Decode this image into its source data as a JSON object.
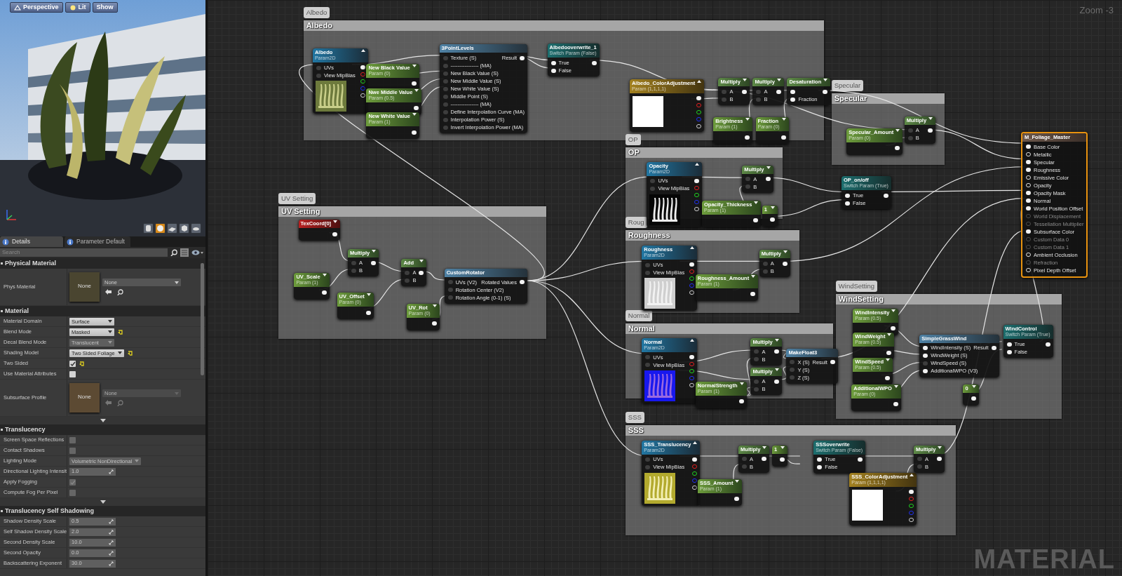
{
  "viewport": {
    "buttons": [
      {
        "label": "Perspective"
      },
      {
        "label": "Lit"
      },
      {
        "label": "Show"
      }
    ],
    "preview_shapes": [
      {
        "selected": false
      },
      {
        "selected": true
      },
      {
        "selected": false
      },
      {
        "selected": false
      },
      {
        "selected": false
      }
    ]
  },
  "details": {
    "tabs": [
      {
        "label": "Details",
        "selected": true
      },
      {
        "label": "Parameter Default",
        "selected": false
      }
    ],
    "search": {
      "placeholder": "Search"
    },
    "sections": [
      {
        "title": "Physical Material",
        "more": false,
        "rows": [
          {
            "kind": "asset",
            "label": "Phys Material",
            "thumbnail": "None",
            "value": "None",
            "color": "#4a4530",
            "disabled": false
          }
        ]
      },
      {
        "title": "Material",
        "more": true,
        "rows": [
          {
            "kind": "dropdown",
            "label": "Material Domain",
            "value": "Surface",
            "disabled": false,
            "reset": false
          },
          {
            "kind": "dropdown",
            "label": "Blend Mode",
            "value": "Masked",
            "disabled": false,
            "reset": true
          },
          {
            "kind": "dropdown",
            "label": "Decal Blend Mode",
            "value": "Translucent",
            "disabled": true,
            "reset": false
          },
          {
            "kind": "dropdown",
            "label": "Shading Model",
            "value": "Two Sided Foliage",
            "disabled": false,
            "reset": true
          },
          {
            "kind": "checkbox",
            "label": "Two Sided",
            "checked": true,
            "disabled": false,
            "reset": true
          },
          {
            "kind": "checkbox",
            "label": "Use Material Attributes",
            "checked": false,
            "disabled": false,
            "reset": false
          },
          {
            "kind": "asset",
            "label": "Subsurface Profile",
            "thumbnail": "None",
            "value": "None",
            "color": "#5c4a33",
            "disabled": true
          }
        ]
      },
      {
        "title": "Translucency",
        "more": true,
        "rows": [
          {
            "kind": "checkbox",
            "label": "Screen Space Reflections",
            "checked": false,
            "disabled": true,
            "reset": false
          },
          {
            "kind": "checkbox",
            "label": "Contact Shadows",
            "checked": false,
            "disabled": true,
            "reset": false
          },
          {
            "kind": "dropdown",
            "label": "Lighting Mode",
            "value": "Volumetric NonDirectional",
            "disabled": true,
            "reset": false
          },
          {
            "kind": "number",
            "label": "Directional Lighting Intensit",
            "value": "1.0",
            "disabled": true
          },
          {
            "kind": "checkbox",
            "label": "Apply Fogging",
            "checked": true,
            "disabled": true,
            "reset": false
          },
          {
            "kind": "checkbox",
            "label": "Compute Fog Per Pixel",
            "checked": false,
            "disabled": true,
            "reset": false
          }
        ]
      },
      {
        "title": "Translucency Self Shadowing",
        "more": false,
        "rows": [
          {
            "kind": "number",
            "label": "Shadow Density Scale",
            "value": "0.5",
            "disabled": true
          },
          {
            "kind": "number",
            "label": "Self Shadow Density Scale",
            "value": "2.0",
            "disabled": true
          },
          {
            "kind": "number",
            "label": "Second Density Scale",
            "value": "10.0",
            "disabled": true
          },
          {
            "kind": "number",
            "label": "Second Opacity",
            "value": "0.0",
            "disabled": true
          },
          {
            "kind": "number",
            "label": "Backscattering Exponent",
            "value": "30.0",
            "disabled": true
          }
        ]
      }
    ]
  },
  "graph": {
    "zoom": "Zoom -3",
    "type_label": "MATERIAL",
    "comments": [
      {
        "bubble": "Albedo",
        "title": "Albedo"
      },
      {
        "bubble": "Specular",
        "title": "Specular"
      },
      {
        "bubble": "OP",
        "title": "OP"
      },
      {
        "bubble": "UV Setting",
        "title": "UV Setting"
      },
      {
        "bubble": "Roug",
        "title": "Roughness"
      },
      {
        "bubble": "WindSetting",
        "title": "WindSetting"
      },
      {
        "bubble": "Normal",
        "title": "Normal"
      },
      {
        "bubble": "SSS",
        "title": "SSS"
      }
    ],
    "nodes": [
      {
        "kind": "texture",
        "title": "Albedo",
        "subtitle": "Param2D",
        "inputs": [
          {
            "label": "UVs",
            "linked": false
          },
          {
            "label": "View MipBias",
            "linked": false
          }
        ]
      },
      {
        "kind": "param",
        "title": "New Black Value",
        "subtitle": "Param (0)"
      },
      {
        "kind": "param",
        "title": "Nwe Middle Value",
        "subtitle": "Param (0.5)"
      },
      {
        "kind": "param",
        "title": "New White Value",
        "subtitle": "Param (1)"
      },
      {
        "kind": "function",
        "title": "3PointLevels",
        "output": "Result",
        "inputs": [
          {
            "label": "Texture (S)",
            "linked": false
          },
          {
            "label": "---------------- (MA)",
            "linked": false
          },
          {
            "label": "New Black Value (S)",
            "linked": false
          },
          {
            "label": "New Middle Value (S)",
            "linked": false
          },
          {
            "label": "New White Value (S)",
            "linked": false
          },
          {
            "label": "Middle Point (S)",
            "linked": false
          },
          {
            "label": "---------------- (MA)",
            "linked": false
          },
          {
            "label": "Define Interpolation Curve (MA)",
            "linked": false
          },
          {
            "label": "Interpolation Power (S)",
            "linked": false
          },
          {
            "label": "Invert Interpolation Power (MA)",
            "linked": false
          }
        ]
      },
      {
        "kind": "switch",
        "title": "Albedooverwrite_1",
        "subtitle": "Switch Param (False)",
        "inputs": [
          {
            "label": "True",
            "linked": true
          },
          {
            "label": "False",
            "linked": true
          }
        ]
      },
      {
        "kind": "vector",
        "title": "Albedo_ColorAdjustment",
        "subtitle": "Param (1,1,1,1)"
      },
      {
        "kind": "math",
        "title": "Multiply",
        "inputs": [
          {
            "label": "A",
            "linked": false
          },
          {
            "label": "B",
            "linked": false
          }
        ]
      },
      {
        "kind": "math",
        "title": "Multiply",
        "inputs": [
          {
            "label": "A",
            "linked": false
          },
          {
            "label": "B",
            "linked": false
          }
        ]
      },
      {
        "kind": "math",
        "title": "Desaturation",
        "inputs": [
          {
            "linked": true
          },
          {
            "label": "Fraction",
            "linked": true
          }
        ]
      },
      {
        "kind": "param",
        "title": "Brightness",
        "subtitle": "Param (1)"
      },
      {
        "kind": "param",
        "title": "Fraction",
        "subtitle": "Param (0)"
      },
      {
        "kind": "param",
        "title": "Specular_Amount",
        "subtitle": "Param (0)"
      },
      {
        "kind": "math",
        "title": "Multiply",
        "inputs": [
          {
            "label": "A",
            "linked": false
          },
          {
            "label": "B",
            "linked": false
          }
        ]
      },
      {
        "kind": "master",
        "title": "M_Foliage_Master",
        "inputs": [
          {
            "label": "Base Color",
            "linked": true,
            "disabled": false
          },
          {
            "label": "Metallic",
            "linked": false,
            "disabled": false
          },
          {
            "label": "Specular",
            "linked": true,
            "disabled": false
          },
          {
            "label": "Roughness",
            "linked": true,
            "disabled": false
          },
          {
            "label": "Emissive Color",
            "linked": false,
            "disabled": false
          },
          {
            "label": "Opacity",
            "linked": false,
            "disabled": false
          },
          {
            "label": "Opacity Mask",
            "linked": true,
            "disabled": false
          },
          {
            "label": "Normal",
            "linked": true,
            "disabled": false
          },
          {
            "label": "World Position Offset",
            "linked": true,
            "disabled": false
          },
          {
            "label": "World Displacement",
            "linked": false,
            "disabled": true
          },
          {
            "label": "Tessellation Multiplier",
            "linked": false,
            "disabled": true
          },
          {
            "label": "Subsurface Color",
            "linked": true,
            "disabled": false
          },
          {
            "label": "Custom Data 0",
            "linked": false,
            "disabled": true
          },
          {
            "label": "Custom Data 1",
            "linked": false,
            "disabled": true
          },
          {
            "label": "Ambient Occlusion",
            "linked": false,
            "disabled": false
          },
          {
            "label": "Refraction",
            "linked": false,
            "disabled": true
          },
          {
            "label": "Pixel Depth Offset",
            "linked": false,
            "disabled": false
          }
        ]
      },
      {
        "kind": "texture",
        "title": "Opacity",
        "subtitle": "Param2D",
        "inputs": [
          {
            "label": "UVs",
            "linked": false
          },
          {
            "label": "View MipBias",
            "linked": false
          }
        ]
      },
      {
        "kind": "math",
        "title": "Multiply",
        "inputs": [
          {
            "label": "A",
            "linked": false
          },
          {
            "label": "B",
            "linked": false
          }
        ]
      },
      {
        "kind": "param",
        "title": "Opacity_Thickness",
        "subtitle": "Param (1)"
      },
      {
        "kind": "constant",
        "title": "1"
      },
      {
        "kind": "switch",
        "title": "OP_on/off",
        "subtitle": "Switch Param (True)",
        "inputs": [
          {
            "label": "True",
            "linked": true
          },
          {
            "label": "False",
            "linked": true
          }
        ]
      },
      {
        "kind": "coord",
        "title": "TexCoord[0]"
      },
      {
        "kind": "math",
        "title": "Multiply",
        "inputs": [
          {
            "label": "A",
            "linked": false
          },
          {
            "label": "B",
            "linked": false
          }
        ]
      },
      {
        "kind": "param",
        "title": "UV_Scale",
        "subtitle": "Param (1)"
      },
      {
        "kind": "param",
        "title": "UV_Offset",
        "subtitle": "Param (0)"
      },
      {
        "kind": "math",
        "title": "Add",
        "inputs": [
          {
            "label": "A",
            "linked": false
          },
          {
            "label": "B",
            "linked": false
          }
        ]
      },
      {
        "kind": "param",
        "title": "UV_Rot",
        "subtitle": "Param (0)"
      },
      {
        "kind": "function",
        "title": "CustomRotator",
        "output": "Rotated Values",
        "inputs": [
          {
            "label": "UVs (V2)",
            "linked": false
          },
          {
            "label": "Rotation Center (V2)",
            "linked": false
          },
          {
            "label": "Rotation Angle (0-1) (S)",
            "linked": false
          }
        ]
      },
      {
        "kind": "texture",
        "title": "Roughness",
        "subtitle": "Param2D",
        "inputs": [
          {
            "label": "UVs",
            "linked": false
          },
          {
            "label": "View MipBias",
            "linked": false
          }
        ]
      },
      {
        "kind": "math",
        "title": "Multiply",
        "inputs": [
          {
            "label": "A",
            "linked": false
          },
          {
            "label": "B",
            "linked": false
          }
        ]
      },
      {
        "kind": "param",
        "title": "Roughness_Amount",
        "subtitle": "Param (1)"
      },
      {
        "kind": "param",
        "title": "WindIntensity",
        "subtitle": "Param (0.5)"
      },
      {
        "kind": "param",
        "title": "WindWeight",
        "subtitle": "Param (0.5)"
      },
      {
        "kind": "param",
        "title": "WindSpeed",
        "subtitle": "Param (0.5)"
      },
      {
        "kind": "param",
        "title": "AdditionalWPO",
        "subtitle": "Param (0)"
      },
      {
        "kind": "function",
        "title": "SimpleGrassWind",
        "output": "Result",
        "inputs": [
          {
            "label": "WindIntensity (S)",
            "linked": true
          },
          {
            "label": "WindWeight (S)",
            "linked": true
          },
          {
            "label": "WindSpeed (S)",
            "linked": false
          },
          {
            "label": "AdditionalWPO (V3)",
            "linked": true
          }
        ]
      },
      {
        "kind": "constant",
        "title": "0"
      },
      {
        "kind": "switch",
        "title": "WindControl",
        "subtitle": "Switch Param (True)",
        "inputs": [
          {
            "label": "True",
            "linked": true
          },
          {
            "label": "False",
            "linked": true
          }
        ]
      },
      {
        "kind": "texture",
        "title": "Normal",
        "subtitle": "Param2D",
        "inputs": [
          {
            "label": "UVs",
            "linked": false
          },
          {
            "label": "View MipBias",
            "linked": false
          }
        ]
      },
      {
        "kind": "math",
        "title": "Multiply",
        "inputs": [
          {
            "label": "A",
            "linked": false
          },
          {
            "label": "B",
            "linked": false
          }
        ]
      },
      {
        "kind": "math",
        "title": "Multiply",
        "inputs": [
          {
            "label": "A",
            "linked": false
          },
          {
            "label": "B",
            "linked": false
          }
        ]
      },
      {
        "kind": "function",
        "title": "MakeFloat3",
        "output": "Result",
        "inputs": [
          {
            "label": "X (S)",
            "linked": false
          },
          {
            "label": "Y (S)",
            "linked": false
          },
          {
            "label": "Z (S)",
            "linked": false
          }
        ]
      },
      {
        "kind": "param",
        "title": "NormalStrength",
        "subtitle": "Param (1)"
      },
      {
        "kind": "texture",
        "title": "SSS_Translucency",
        "subtitle": "Param2D",
        "inputs": [
          {
            "label": "UVs",
            "linked": false
          },
          {
            "label": "View MipBias",
            "linked": false
          }
        ]
      },
      {
        "kind": "math",
        "title": "Multiply",
        "inputs": [
          {
            "label": "A",
            "linked": false
          },
          {
            "label": "B",
            "linked": false
          }
        ]
      },
      {
        "kind": "constant",
        "title": "1"
      },
      {
        "kind": "switch",
        "title": "SSSoverwrite",
        "subtitle": "Switch Param (False)",
        "inputs": [
          {
            "label": "True",
            "linked": true
          },
          {
            "label": "False",
            "linked": true
          }
        ]
      },
      {
        "kind": "param",
        "title": "SSS_Amount",
        "subtitle": "Param (1)"
      },
      {
        "kind": "vector",
        "title": "SSS_ColorAdjustment",
        "subtitle": "Param (1,1,1,1)"
      },
      {
        "kind": "math",
        "title": "Multiply",
        "inputs": [
          {
            "label": "A",
            "linked": false
          },
          {
            "label": "B",
            "linked": false
          }
        ]
      }
    ]
  }
}
